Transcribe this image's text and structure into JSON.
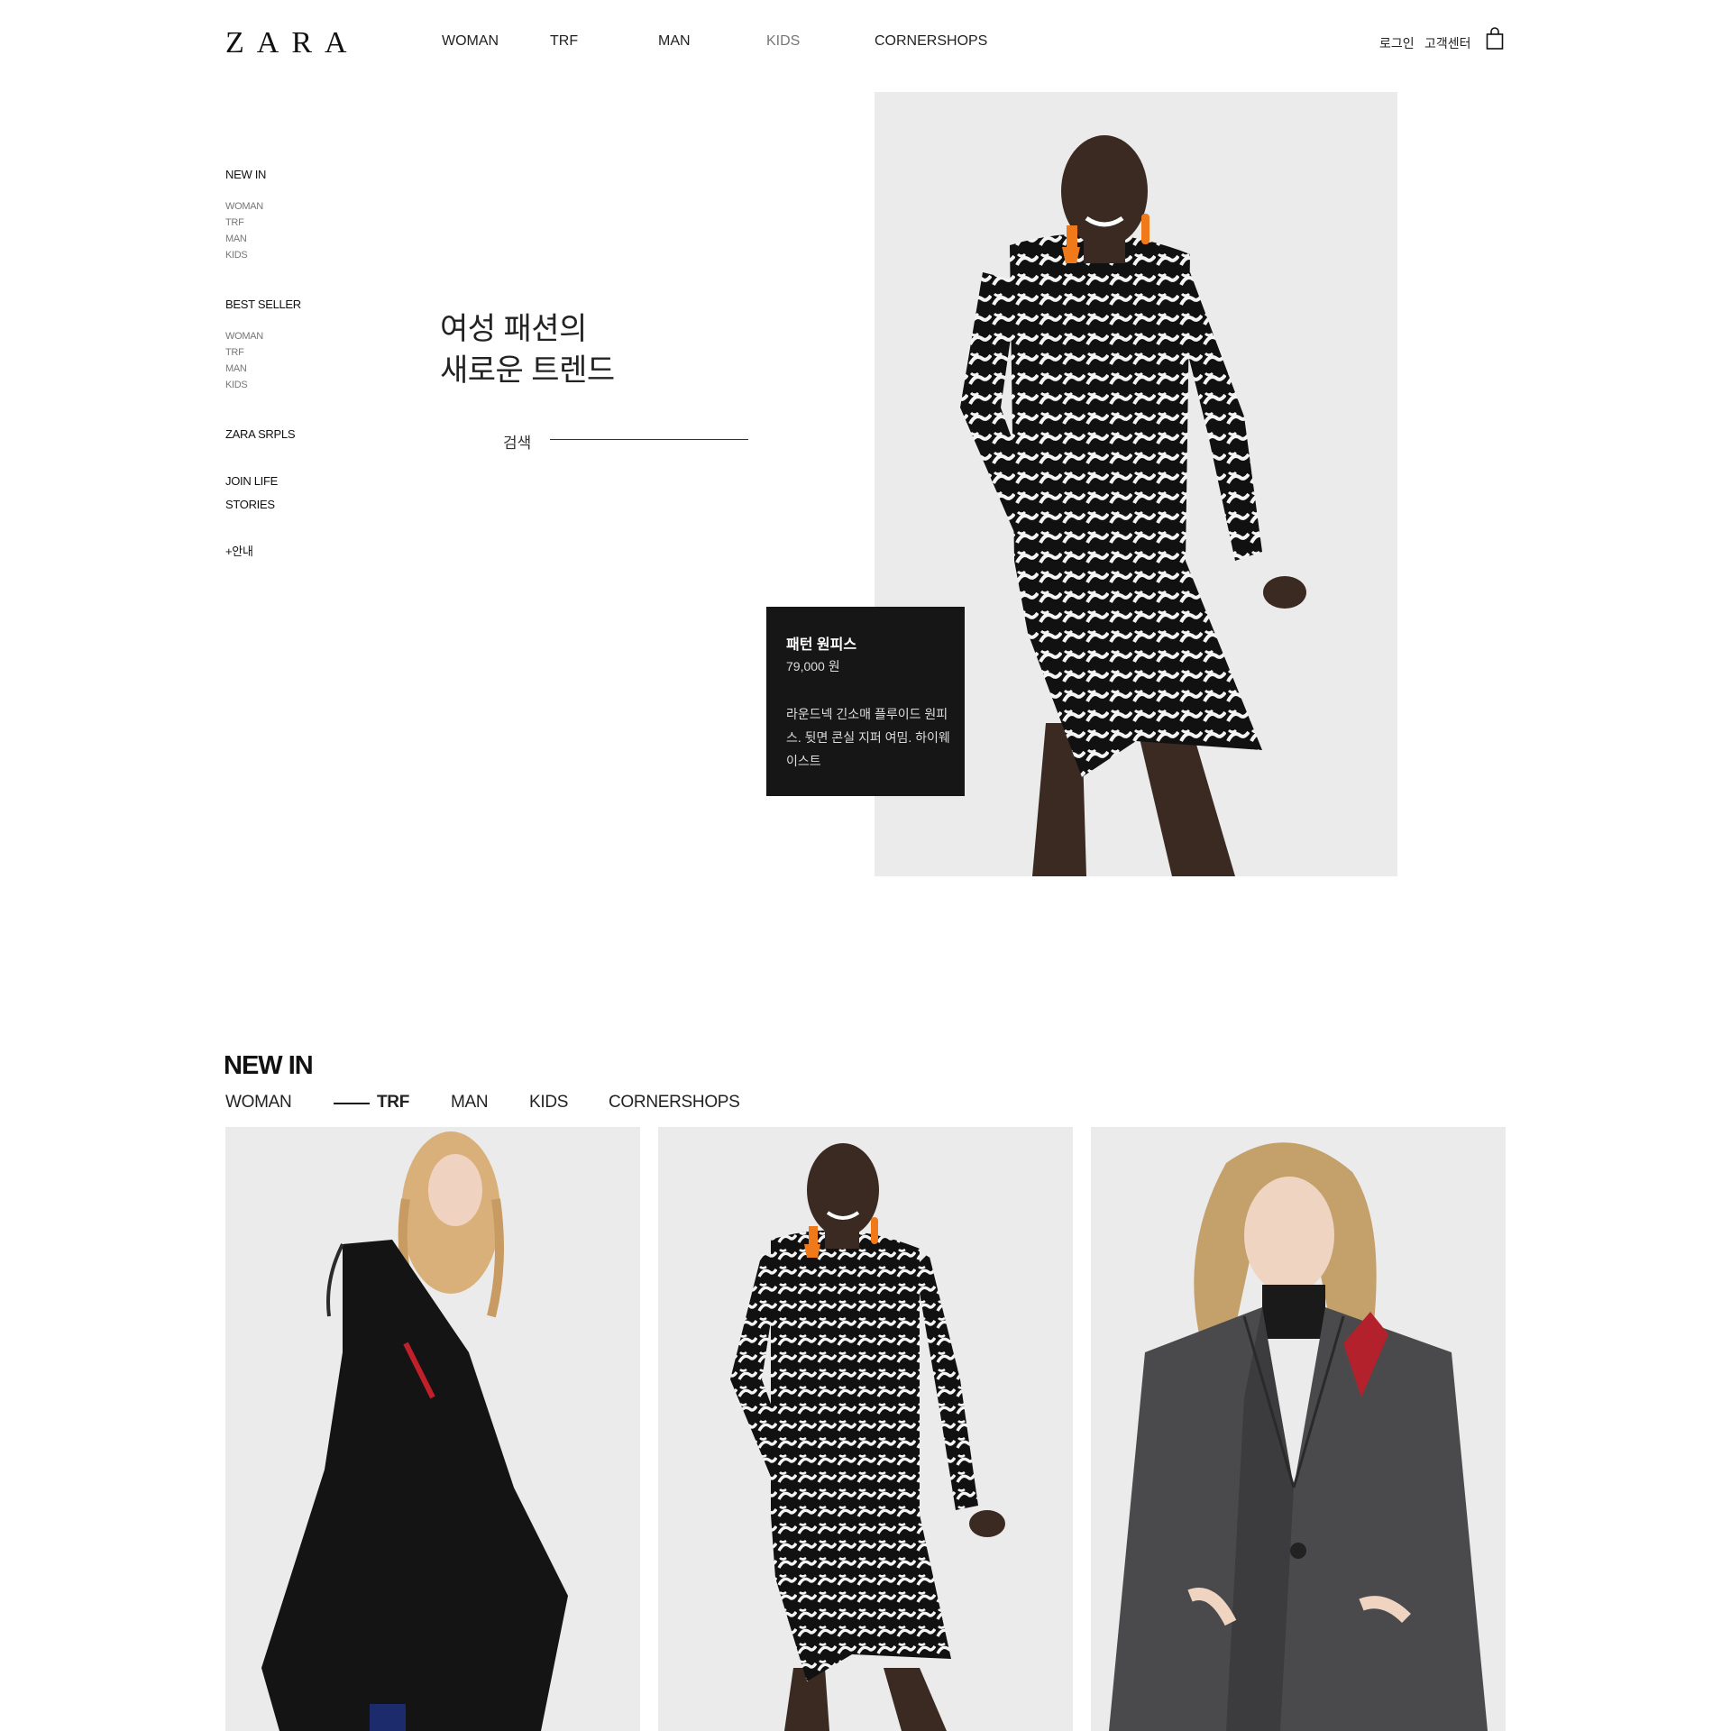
{
  "header": {
    "logo": "ZARA",
    "nav": [
      "WOMAN",
      "TRF",
      "MAN",
      "KIDS",
      "CORNERSHOPS"
    ],
    "login": "로그인",
    "customer_center": "고객센터",
    "cart_icon": "shopping-bag-icon"
  },
  "sidebar": {
    "new_in": {
      "title": "NEW IN",
      "items": [
        "WOMAN",
        "TRF",
        "MAN",
        "KIDS"
      ]
    },
    "best_seller": {
      "title": "BEST SELLER",
      "items": [
        "WOMAN",
        "TRF",
        "MAN",
        "KIDS"
      ]
    },
    "zara_srpls": "ZARA SRPLS",
    "join_life": "JOIN LIFE",
    "stories": "STORIES",
    "info": "+안내"
  },
  "hero": {
    "title_line1": "여성 패션의",
    "title_line2": "새로운 트렌드",
    "search_label": "검색",
    "product": {
      "name": "패턴 원피스",
      "price": "79,000 원",
      "description": "라운드넥 긴소매 플루이드 원피스. 뒷면 콘실 지퍼 여밈. 하이웨이스트"
    }
  },
  "new_in_section": {
    "title": "NEW IN",
    "tabs": [
      "WOMAN",
      "TRF",
      "MAN",
      "KIDS",
      "CORNERSHOPS"
    ],
    "active_tab": "TRF"
  },
  "colors": {
    "background": "#ffffff",
    "text": "#111111",
    "photo_bg": "#ebebeb",
    "info_box": "#161616",
    "accent_orange": "#f07a1a"
  }
}
